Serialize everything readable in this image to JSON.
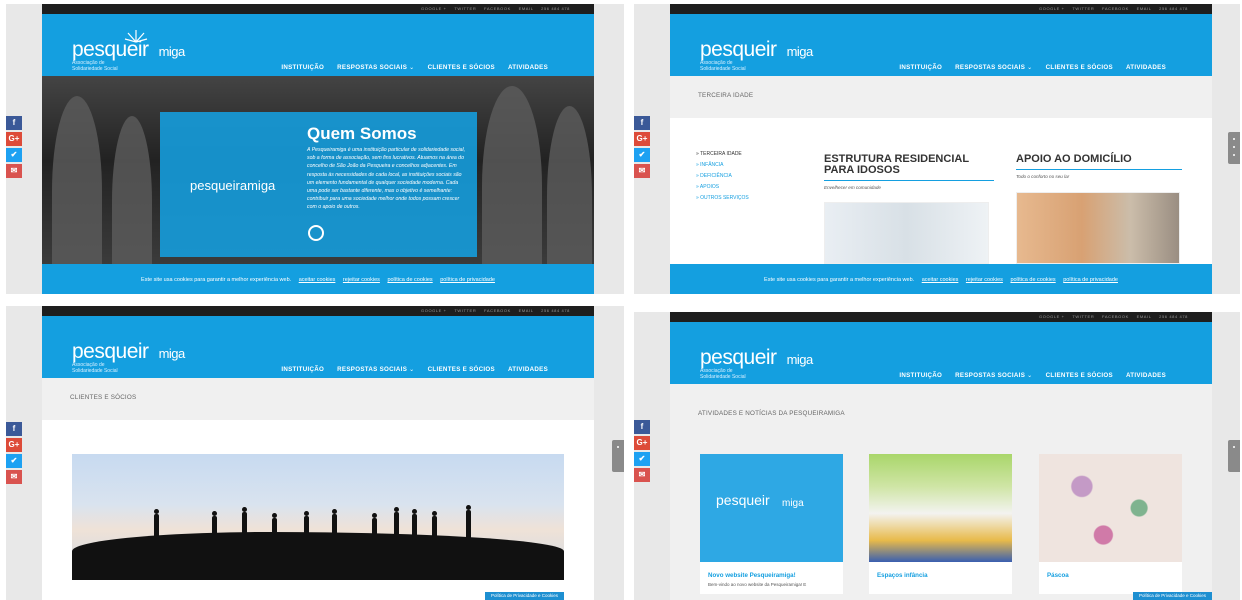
{
  "site": {
    "logo_main": "pesqueir",
    "logo_tail": "miga",
    "logo_sub_1": "Associação de",
    "logo_sub_2": "Solidariedade Social",
    "topbar": [
      "GOOGLE +",
      "TWITTER",
      "FACEBOOK",
      "EMAIL",
      "256 484 478"
    ],
    "nav": [
      "INSTITUIÇÃO",
      "RESPOSTAS SOCIAIS",
      "CLIENTES E SÓCIOS",
      "ATIVIDADES"
    ],
    "share_icons": [
      "facebook-icon",
      "google-plus-icon",
      "twitter-icon",
      "email-icon"
    ],
    "share_glyphs": [
      "f",
      "G+",
      "✔",
      "✉"
    ],
    "colors": {
      "brand": "#149fe0",
      "topbar": "#1e1e1e",
      "facebook": "#3b5998",
      "googleplus": "#dd4b39",
      "twitter": "#1da1f2",
      "email": "#d9534f"
    }
  },
  "cookie": {
    "text": "Este site usa cookies para garantir a melhor experiência web.",
    "accept": "aceitar cookies",
    "reject": "rejeitar cookies",
    "cookie_policy": "política de cookies",
    "privacy_policy": "política de privacidade"
  },
  "panel1": {
    "title": "Quem Somos",
    "brand": "pesqueiramiga",
    "body": "A Pesqueiramiga é uma instituição particular de solidariedade social, sob a forma de associação, sem fins lucrativos. Atuamos na área do concelho de São João da Pesqueira e concelhos adjacentes. Em resposta às necessidades de cada local, as instituições sociais são um elemento fundamental de qualquer sociedade moderna. Cada uma pode ser bastante diferente, mas o objetivo é semelhante: contribuir para uma sociedade melhor onde todos possam crescer com o apoio de outros."
  },
  "panel2": {
    "strip": "TERCEIRA IDADE",
    "sidebar": [
      "TERCEIRA IDADE",
      "INFÂNCIA",
      "DEFICIÊNCIA",
      "APOIOS",
      "OUTROS SERVIÇOS"
    ],
    "card1_title_1": "ESTRUTURA RESIDENCIAL",
    "card1_title_2": "PARA IDOSOS",
    "card1_sub": "Envelhecer em comunidade",
    "card2_title": "APOIO AO DOMICÍLIO",
    "card2_sub": "Todo o conforto no seu lar"
  },
  "panel3": {
    "strip": "CLIENTES E SÓCIOS",
    "privacy_button": "Política de Privacidade e Cookies"
  },
  "panel4": {
    "strip": "ATIVIDADES E NOTÍCIAS DA PESQUEIRAMIGA",
    "tiles": [
      {
        "title": "Novo website Pesqueiramiga!",
        "text": "Bem-vindo ao novo website da Pesqueiramiga! E"
      },
      {
        "title": "Espaços infância",
        "text": ""
      },
      {
        "title": "Páscoa",
        "text": ""
      }
    ],
    "privacy_button": "Política de Privacidade e Cookies"
  }
}
